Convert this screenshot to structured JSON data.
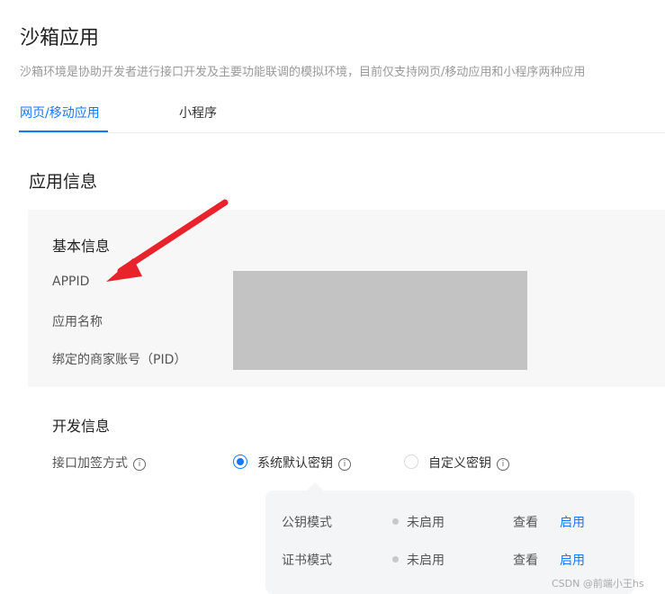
{
  "header": {
    "title": "沙箱应用",
    "description": "沙箱环境是协助开发者进行接口开发及主要功能联调的模拟环境，目前仅支持网页/移动应用和小程序两种应用"
  },
  "tabs": [
    {
      "label": "网页/移动应用",
      "active": true
    },
    {
      "label": "小程序",
      "active": false
    }
  ],
  "section_title": "应用信息",
  "basic_info": {
    "title": "基本信息",
    "fields": [
      {
        "label": "APPID"
      },
      {
        "label": "应用名称"
      },
      {
        "label": "绑定的商家账号（PID）"
      }
    ]
  },
  "dev_info": {
    "title": "开发信息",
    "sign_label": "接口加签方式",
    "options": [
      {
        "label": "系统默认密钥",
        "selected": true
      },
      {
        "label": "自定义密钥",
        "selected": false
      }
    ],
    "modes": [
      {
        "label": "公钥模式",
        "status": "未启用",
        "view": "查看",
        "enable": "启用"
      },
      {
        "label": "证书模式",
        "status": "未启用",
        "view": "查看",
        "enable": "启用"
      }
    ]
  },
  "watermark": "CSDN @前端小王hs",
  "colors": {
    "accent": "#1677ff",
    "annotation_arrow": "#e8232b"
  },
  "icons": {
    "info": "info-circle-icon"
  }
}
